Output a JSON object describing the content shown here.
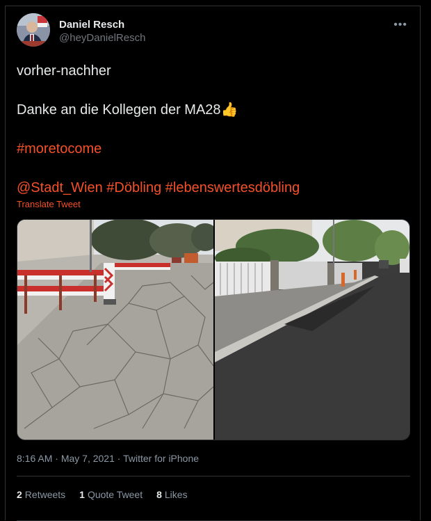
{
  "author": {
    "display_name": "Daniel Resch",
    "handle": "@heyDanielResch",
    "avatar_icon": "profile-photo"
  },
  "more_icon": "ellipsis-icon",
  "tweet": {
    "line1": "vorher-nachher",
    "line2": "Danke an die Kollegen der MA28",
    "line2_emoji": "👍",
    "hashtag1": "#moretocome",
    "mention": "@Stadt_Wien",
    "hashtag2": "#Döbling",
    "hashtag3": "#lebenswertesdöbling"
  },
  "translate_label": "Translate Tweet",
  "media": {
    "left_label": "before-photo",
    "right_label": "after-photo"
  },
  "meta": {
    "time": "8:16 AM",
    "date": "May 7, 2021",
    "source": "Twitter for iPhone",
    "separator": "·"
  },
  "stats": {
    "retweets_count": "2",
    "retweets_label": "Retweets",
    "quotes_count": "1",
    "quotes_label": "Quote Tweet",
    "likes_count": "8",
    "likes_label": "Likes"
  },
  "colors": {
    "accent": "#f4502a",
    "background": "#000000",
    "text": "#e7e9ea",
    "muted": "#8b98a5"
  }
}
